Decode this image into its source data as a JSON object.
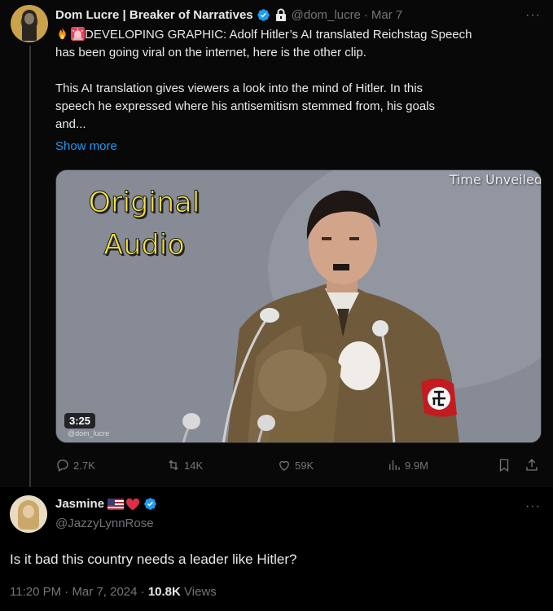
{
  "tweet1": {
    "author_name": "Dom Lucre | Breaker of Narratives",
    "handle": "@dom_lucre",
    "separator": "·",
    "date": "Mar 7",
    "more_menu": "···",
    "text_line1": "DEVELOPING GRAPHIC: Adolf Hitler’s AI translated Reichstag Speech",
    "text_line2": "has been going viral on the internet, here is the other clip.",
    "text_para2_line1": "This AI translation gives viewers a look into the mind of Hitler. In this",
    "text_para2_line2": "speech he expressed where his antisemitism stemmed from, his goals",
    "text_para2_line3": "and...",
    "show_more": "Show more",
    "emojis": [
      "fire-emoji",
      "alarm-light-emoji"
    ],
    "video": {
      "overlay_text_line1": "Original",
      "overlay_text_line2": "Audio",
      "watermark": "Time Unveiled",
      "duration": "3:25",
      "video_handle": "@dom_lucre"
    },
    "actions": {
      "replies": "2.7K",
      "reposts": "14K",
      "likes": "59K",
      "views": "9.9M"
    }
  },
  "tweet2": {
    "author_name": "Jasmine",
    "name_emojis": [
      "us-flag-emoji",
      "red-heart-emoji"
    ],
    "handle": "@JazzyLynnRose",
    "more_menu": "···",
    "text": "Is it bad this country needs a leader like Hitler?",
    "time": "11:20 PM",
    "meta_separator": "·",
    "date": "Mar 7, 2024",
    "views_count": "10.8K",
    "views_label": "Views"
  },
  "colors": {
    "background": "#000000",
    "text_primary": "#e7e9ea",
    "text_secondary": "#71767b",
    "link": "#1d9bf0",
    "verified": "#1d9bf0",
    "overlay_text": "#f3e23a"
  }
}
